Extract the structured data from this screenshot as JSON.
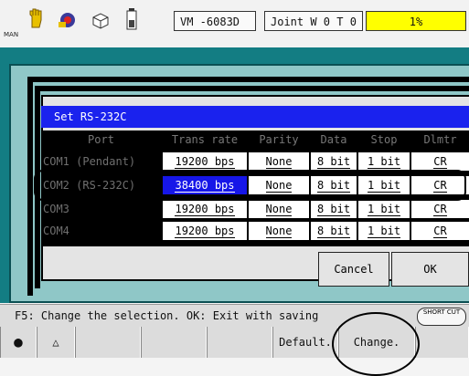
{
  "top_bar": {
    "man_label": "MAN",
    "mode_text": "VM  -6083D",
    "joint_text": "Joint  W 0 T 0",
    "speed_text": "1%",
    "icons": [
      "hand-icon",
      "gear-icon",
      "cube-icon",
      "battery-icon"
    ]
  },
  "dialog": {
    "title": "Set RS-232C",
    "columns": [
      "Port",
      "Trans rate",
      "Parity",
      "Data",
      "Stop",
      "Dlmtr"
    ],
    "rows": [
      {
        "port": "COM1 (Pendant)",
        "rate": "19200 bps",
        "parity": "None",
        "data": "8 bit",
        "stop": "1 bit",
        "dlmtr": "CR"
      },
      {
        "port": "COM2 (RS-232C)",
        "rate": "38400 bps",
        "parity": "None",
        "data": "8 bit",
        "stop": "1 bit",
        "dlmtr": "CR"
      },
      {
        "port": "COM3",
        "rate": "19200 bps",
        "parity": "None",
        "data": "8 bit",
        "stop": "1 bit",
        "dlmtr": "CR"
      },
      {
        "port": "COM4",
        "rate": "19200 bps",
        "parity": "None",
        "data": "8 bit",
        "stop": "1 bit",
        "dlmtr": "CR"
      }
    ],
    "cancel_label": "Cancel",
    "ok_label": "OK"
  },
  "status_text": "F5: Change the selection.  OK: Exit with saving",
  "shortcut_label": "SHORT CUT",
  "function_keys": {
    "f1": "●",
    "f2": "△",
    "f3": "",
    "f4": "",
    "f5": "Default.",
    "f6": "Change.",
    "f7": ""
  },
  "colors": {
    "title_bar": "#1a22ee",
    "selected_cell": "#1616e8",
    "panel": "#137d83",
    "speed_field": "#ffff00"
  }
}
